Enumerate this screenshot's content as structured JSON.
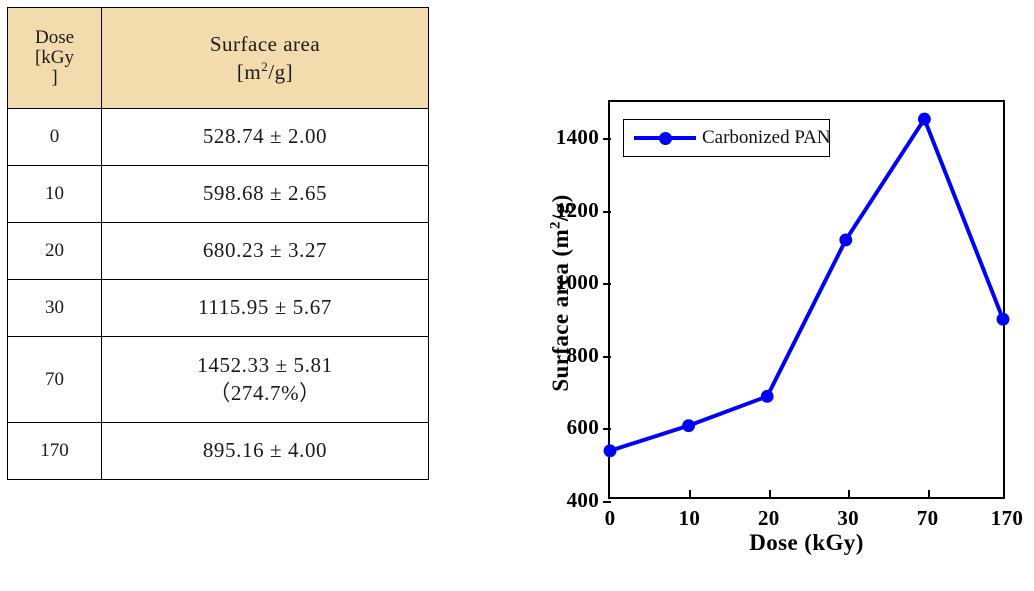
{
  "table": {
    "headers": {
      "dose_lines": [
        "Dose",
        "[kGy",
        "]"
      ],
      "area_lines": [
        "Surface area",
        "[m",
        "2",
        "/g]"
      ]
    },
    "rows": [
      {
        "dose": "0",
        "area": "528.74 ± 2.00",
        "note": ""
      },
      {
        "dose": "10",
        "area": "598.68 ± 2.65",
        "note": ""
      },
      {
        "dose": "20",
        "area": "680.23 ± 3.27",
        "note": ""
      },
      {
        "dose": "30",
        "area": "1115.95 ± 5.67",
        "note": ""
      },
      {
        "dose": "70",
        "area": "1452.33 ± 5.81",
        "note": "（274.7%）"
      },
      {
        "dose": "170",
        "area": "895.16 ± 4.00",
        "note": ""
      }
    ],
    "header_background": "#f2dcae",
    "border_color": "#000000"
  },
  "chart_data": {
    "type": "line",
    "title": "",
    "categories": [
      "0",
      "10",
      "20",
      "30",
      "70",
      "170"
    ],
    "series": [
      {
        "name": "Carbonized PAN",
        "values": [
          528.74,
          598.68,
          680.23,
          1115.95,
          1452.33,
          895.16
        ],
        "color": "#0000ff",
        "marker": "circle"
      }
    ],
    "xlabel": "Dose (kGy)",
    "ylabel_parts": {
      "pre": "Surface area (m",
      "sup": "2",
      "post": "/g)"
    },
    "ylabel": "Surface area (m2/g)",
    "ylim": [
      400,
      1500
    ],
    "yticks": [
      "400",
      "600",
      "800",
      "1000",
      "1200",
      "1400"
    ],
    "ytick_values": [
      400,
      600,
      800,
      1000,
      1200,
      1400
    ],
    "xticks": [
      "0",
      "10",
      "20",
      "30",
      "70",
      "170"
    ],
    "grid": false,
    "legend_position": "top-left",
    "legend_entries": [
      "Carbonized PAN"
    ]
  }
}
